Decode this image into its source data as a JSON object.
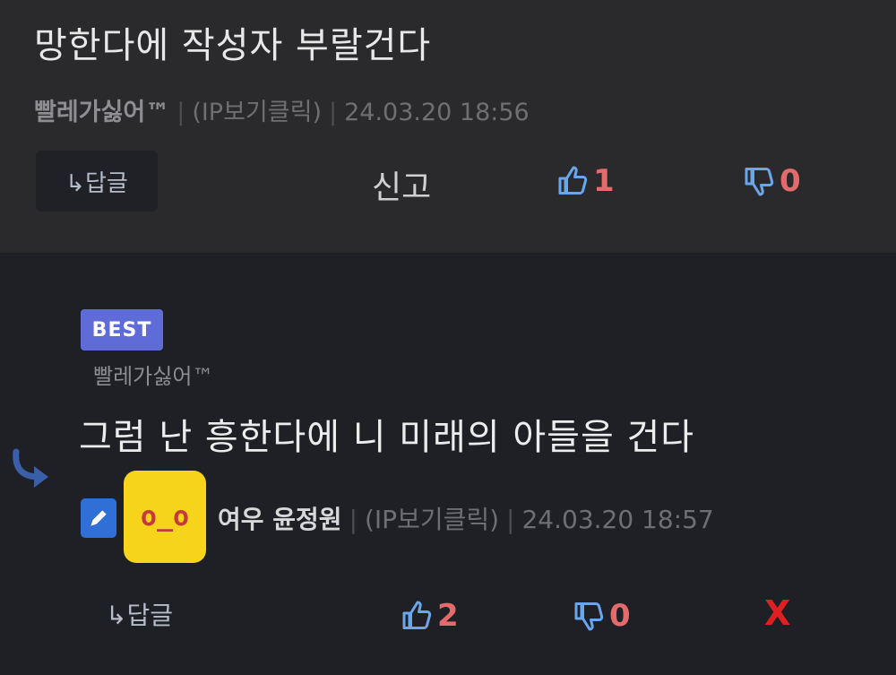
{
  "comment1": {
    "text": "망한다에 작성자 부랄건다",
    "author": "빨레가싫어™",
    "ip": "(IP보기클릭)",
    "datetime": "24.03.20 18:56",
    "reply_label": "↳답글",
    "report_label": "신고",
    "likes": "1",
    "dislikes": "0"
  },
  "comment2": {
    "badge": "BEST",
    "mention": "빨레가싫어™",
    "text": "그럼 난 흥한다에 니 미래의 아들을 건다",
    "avatar_text": "o_o",
    "author": "여우 윤정원",
    "ip": "(IP보기클릭)",
    "datetime": "24.03.20 18:57",
    "reply_label": "↳답글",
    "likes": "2",
    "dislikes": "0",
    "delete_label": "X"
  },
  "icons": [
    "thumbs-up-icon",
    "thumbs-down-icon",
    "reply-arrow-icon",
    "pencil-icon"
  ],
  "colors": {
    "count": "#e46b6b",
    "best": "#5f6bd6",
    "avatar": "#f7d41c",
    "delete": "#e02020"
  }
}
